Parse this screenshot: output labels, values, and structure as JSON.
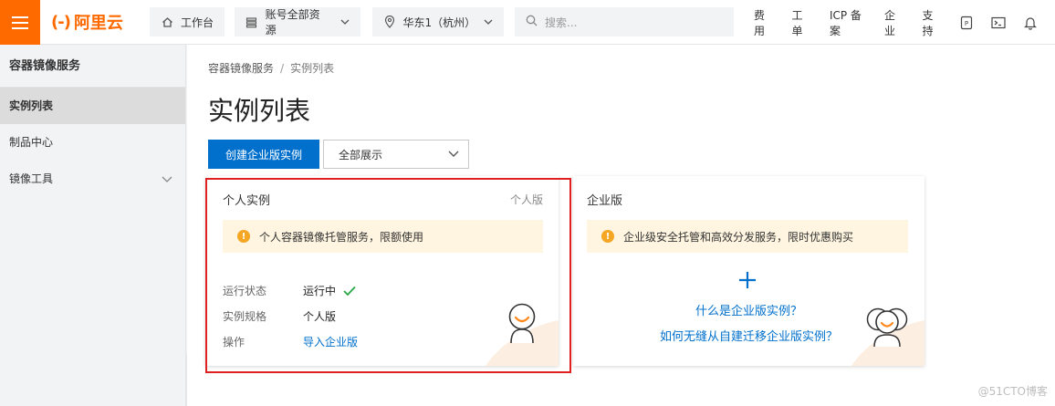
{
  "topbar": {
    "brand": "阿里云",
    "brand_mark": "(-)",
    "workbench": "工作台",
    "resources": "账号全部资源",
    "region": "华东1（杭州）",
    "search_placeholder": "搜索...",
    "links": [
      "费用",
      "工单",
      "ICP 备案",
      "企业",
      "支持"
    ],
    "brand_color": "#ff6a00"
  },
  "sidebar": {
    "title": "容器镜像服务",
    "items": [
      {
        "label": "实例列表",
        "active": true
      },
      {
        "label": "制品中心",
        "active": false
      },
      {
        "label": "镜像工具",
        "active": false,
        "expandable": true
      }
    ]
  },
  "main": {
    "breadcrumb": [
      "容器镜像服务",
      "实例列表"
    ],
    "title": "实例列表",
    "create_button": "创建企业版实例",
    "filter_value": "全部展示",
    "accent_color": "#0070cc"
  },
  "cards": {
    "personal": {
      "title": "个人实例",
      "tag": "个人版",
      "notice": "个人容器镜像托管服务，限额使用",
      "rows": [
        {
          "key": "运行状态",
          "value": "运行中",
          "status": "ok"
        },
        {
          "key": "实例规格",
          "value": "个人版"
        },
        {
          "key": "操作",
          "value": "导入企业版",
          "link": true
        }
      ]
    },
    "enterprise": {
      "title": "企业版",
      "notice": "企业级安全托管和高效分发服务，限时优惠购买",
      "link1": "什么是企业版实例？",
      "link2": "如何无缝从自建迁移企业版实例？"
    }
  },
  "watermark": "@51CTO博客"
}
